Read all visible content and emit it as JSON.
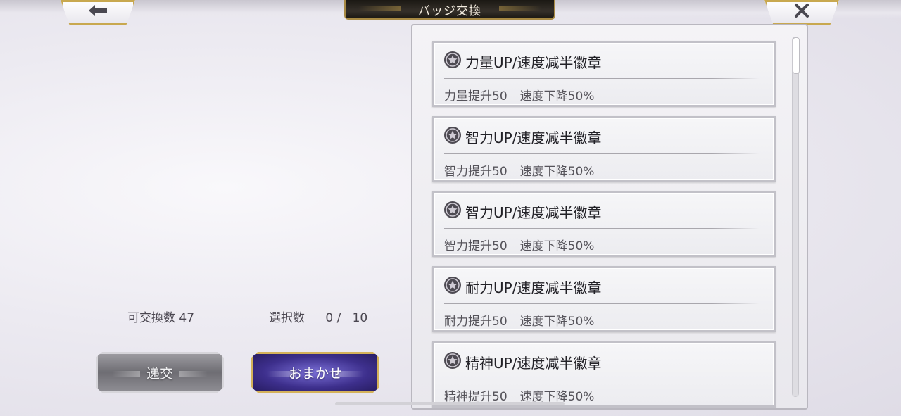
{
  "header": {
    "title": "バッジ交換",
    "back_icon": "arrow-left-icon",
    "close_icon": "close-icon"
  },
  "stats": {
    "exchangeable_label": "可交換数",
    "exchangeable_count": "47",
    "selected_label": "選択数",
    "selected_value": "0 /",
    "selected_max": "10"
  },
  "buttons": {
    "exchange_label": "递交",
    "auto_label": "おまかせ"
  },
  "badges": [
    {
      "name": "力量UP/速度减半徽章",
      "effect_up": "力量提升50",
      "effect_down": "速度下降50%"
    },
    {
      "name": "智力UP/速度减半徽章",
      "effect_up": "智力提升50",
      "effect_down": "速度下降50%"
    },
    {
      "name": "智力UP/速度减半徽章",
      "effect_up": "智力提升50",
      "effect_down": "速度下降50%"
    },
    {
      "name": "耐力UP/速度减半徽章",
      "effect_up": "耐力提升50",
      "effect_down": "速度下降50%"
    },
    {
      "name": "精神UP/速度减半徽章",
      "effect_up": "精神提升50",
      "effect_down": "速度下降50%"
    }
  ],
  "colors": {
    "gold_trim": "#c8a84f",
    "auto_button": "#3d2f8c",
    "exchange_button": "#6e6d73"
  }
}
